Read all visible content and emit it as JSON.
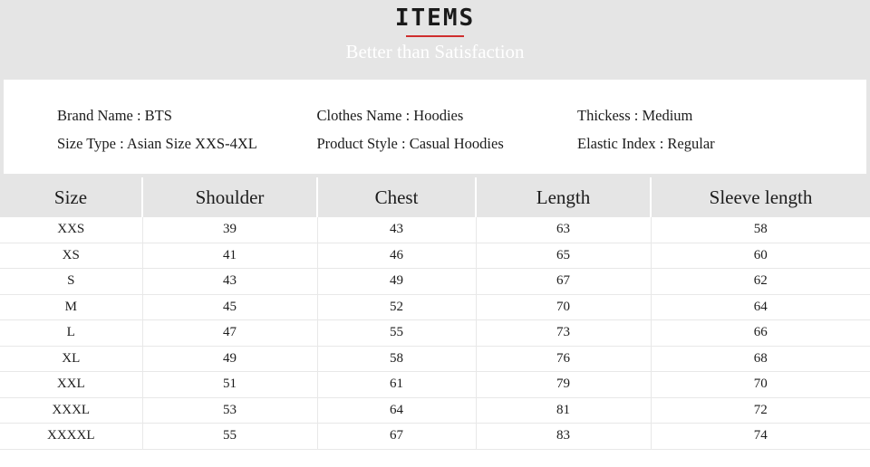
{
  "banner": {
    "title": "ITEMS",
    "subtitle": "Better than Satisfaction",
    "accent_color": "#cf2e2e",
    "background_color": "#e5e5e5",
    "subtitle_color": "#ffffff"
  },
  "info": {
    "columns": [
      [
        "Brand Name : BTS",
        "Size Type : Asian Size XXS-4XL"
      ],
      [
        "Clothes Name : Hoodies",
        "Product Style : Casual Hoodies"
      ],
      [
        "Thickess : Medium",
        "Elastic Index : Regular"
      ]
    ]
  },
  "table": {
    "headers": [
      "Size",
      "Shoulder",
      "Chest",
      "Length",
      "Sleeve length"
    ],
    "rows": [
      [
        "XXS",
        "39",
        "43",
        "63",
        "58"
      ],
      [
        "XS",
        "41",
        "46",
        "65",
        "60"
      ],
      [
        "S",
        "43",
        "49",
        "67",
        "62"
      ],
      [
        "M",
        "45",
        "52",
        "70",
        "64"
      ],
      [
        "L",
        "47",
        "55",
        "73",
        "66"
      ],
      [
        "XL",
        "49",
        "58",
        "76",
        "68"
      ],
      [
        "XXL",
        "51",
        "61",
        "79",
        "70"
      ],
      [
        "XXXL",
        "53",
        "64",
        "81",
        "72"
      ],
      [
        "XXXXL",
        "55",
        "67",
        "83",
        "74"
      ]
    ],
    "header_background": "#e5e5e5",
    "row_divider_color": "#e8e8e8"
  }
}
